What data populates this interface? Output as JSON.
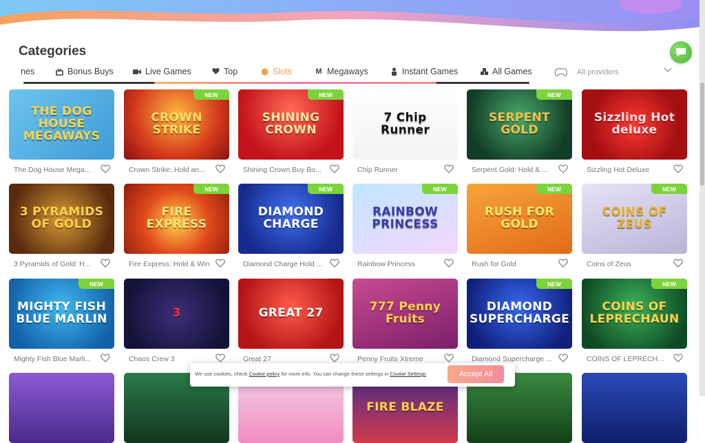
{
  "colors": {
    "accent": "#f2a14f",
    "new_badge": "#7dd33c",
    "text": "#3d3d3d"
  },
  "page": {
    "title": "Categories"
  },
  "tabs": [
    {
      "label": "nes",
      "icon": "partial-icon",
      "active": false
    },
    {
      "label": "Bonus Buys",
      "icon": "bonus-buys-icon",
      "active": false
    },
    {
      "label": "Live Games",
      "icon": "camera-icon",
      "active": false
    },
    {
      "label": "Top",
      "icon": "heart-icon",
      "active": false
    },
    {
      "label": "Slots",
      "icon": "slots-icon",
      "active": true
    },
    {
      "label": "Megaways",
      "icon": "megaways-icon",
      "active": false
    },
    {
      "label": "Instant Games",
      "icon": "instant-icon",
      "active": false
    },
    {
      "label": "All Games",
      "icon": "cubes-icon",
      "active": false
    }
  ],
  "providers": {
    "label": "All providers",
    "icon": "gamepad-icon"
  },
  "new_label": "NEW",
  "games": [
    {
      "name": "The Dog House Mega...",
      "art": "THE DOG HOUSE MEGAWAYS",
      "new": false
    },
    {
      "name": "Crown Strike: Hold an...",
      "art": "CROWN STRIKE",
      "new": true
    },
    {
      "name": "Shining Crown Buy Bo...",
      "art": "SHINING CROWN",
      "new": true
    },
    {
      "name": "Chip Runner",
      "art": "7 Chip Runner",
      "new": false
    },
    {
      "name": "Serpent Gold: Hold & ...",
      "art": "SERPENT GOLD",
      "new": true
    },
    {
      "name": "Sizzling Hot Deluxe",
      "art": "Sizzling Hot deluxe",
      "new": false
    },
    {
      "name": "3 Pyramids of Gold: H...",
      "art": "3 PYRAMIDS OF GOLD",
      "new": false
    },
    {
      "name": "Fire Express: Hold & Win",
      "art": "FIRE EXPRESS",
      "new": true
    },
    {
      "name": "Diamond Charge Hold ...",
      "art": "DIAMOND CHARGE",
      "new": true
    },
    {
      "name": "Rainbow Princess",
      "art": "RAINBOW PRINCESS",
      "new": true
    },
    {
      "name": "Rush for Gold",
      "art": "RUSH FOR GOLD",
      "new": true
    },
    {
      "name": "Coins of Zeus",
      "art": "COINS OF ZEUS",
      "new": true
    },
    {
      "name": "Mighty Fish Blue Marli...",
      "art": "MIGHTY FISH BLUE MARLIN",
      "new": true
    },
    {
      "name": "Chaos Crew 3",
      "art": "3",
      "new": false
    },
    {
      "name": "Great 27",
      "art": "GREAT 27",
      "new": false
    },
    {
      "name": "Penny Fruits Xtreme",
      "art": "777 Penny Fruits",
      "new": false
    },
    {
      "name": "Diamond Supercharge ...",
      "art": "DIAMOND SUPERCHARGE",
      "new": true
    },
    {
      "name": "COINS OF LEPRECHAU...",
      "art": "COINS OF LEPRECHAUN",
      "new": true
    },
    {
      "name": "",
      "art": "",
      "new": false
    },
    {
      "name": "",
      "art": "",
      "new": false
    },
    {
      "name": "",
      "art": "",
      "new": false
    },
    {
      "name": "",
      "art": "FIRE BLAZE",
      "new": false
    },
    {
      "name": "",
      "art": "",
      "new": false
    },
    {
      "name": "",
      "art": "",
      "new": false
    }
  ],
  "cookie": {
    "text_before": "We use cookies, check ",
    "policy_link": "Cookie policy",
    "text_middle": " for more info. You can change these settings in ",
    "settings_link": "Cookie Settings",
    "accept_label": "Accept All"
  }
}
